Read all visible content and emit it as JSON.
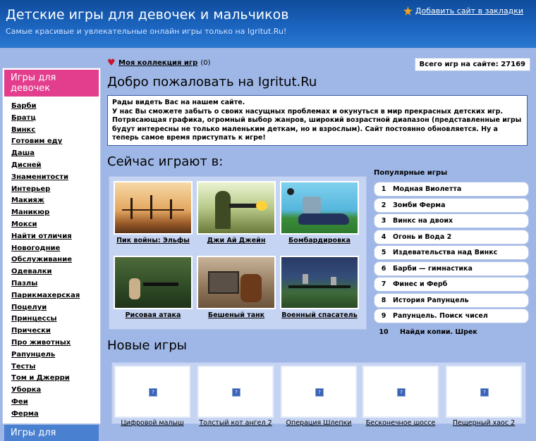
{
  "header": {
    "title": "Детские игры для девочек и мальчиков",
    "subtitle": "Самые красивые и увлекательные онлайн игры только на Igritut.Ru!",
    "bookmark": "Добавить сайт в закладки"
  },
  "sidebar": {
    "section1": "Игры для девочек",
    "items": [
      "Барби",
      "Братц",
      "Винкс",
      "Готовим еду",
      "Даша",
      "Дисней",
      "Знаменитости",
      "Интерьер",
      "Макияж",
      "Маникюр",
      "Мокси",
      "Найти отличия",
      "Новогодние",
      "Обслуживание",
      "Одевалки",
      "Пазлы",
      "Парикмахерская",
      "Поцелуи",
      "Принцессы",
      "Прически",
      "Про животных",
      "Рапунцель",
      "Тесты",
      "Том и Джерри",
      "Уборка",
      "Феи",
      "Ферма"
    ],
    "section2": "Игры для"
  },
  "collection": {
    "link": "Моя коллекция игр",
    "count": "(0)"
  },
  "total": {
    "label": "Всего игр на сайте:",
    "value": "27169"
  },
  "welcome": {
    "title": "Добро пожаловать на Igritut.Ru",
    "lines": [
      "Рады видеть Вас на нашем сайте.",
      "У нас Вы сможете забыть о своих насущных проблемах и окунуться в мир прекрасных детских игр.",
      "Потрясающая графика, огромный выбор жанров, широкий возрастной диапазон (представленные игры будут интересны не только маленьким деткам, но и взрослым). Сайт постоянно обновляется. Ну а теперь самое время приступать к игре!"
    ]
  },
  "now_playing": {
    "title": "Сейчас играют в:",
    "games": [
      "Пик войны: Эльфы",
      "Джи Ай Джейн",
      "Бомбардировка",
      "Рисовая атака",
      "Бешеный танк",
      "Военный спасатель"
    ]
  },
  "popular": {
    "title": "Популярные игры",
    "items": [
      {
        "n": "1",
        "name": "Модная Виолетта"
      },
      {
        "n": "2",
        "name": "Зомби Ферма"
      },
      {
        "n": "3",
        "name": "Винкс на двоих"
      },
      {
        "n": "4",
        "name": "Огонь и Вода 2"
      },
      {
        "n": "5",
        "name": "Издевательства над Винкс"
      },
      {
        "n": "6",
        "name": "Барби — гимнастика"
      },
      {
        "n": "7",
        "name": "Финес и Ферб"
      },
      {
        "n": "8",
        "name": "История Рапунцель"
      },
      {
        "n": "9",
        "name": "Рапунцель. Поиск чисел"
      },
      {
        "n": "10",
        "name": "Найди копии. Шрек"
      }
    ]
  },
  "new_games": {
    "title": "Новые игры",
    "games": [
      "Цифровой малыш",
      "Толстый кот ангел 2",
      "Операция Шлепки",
      "Бесконечное шоссе",
      "Пещерный хаос 2"
    ]
  },
  "colors": {
    "header": "#1c66c1",
    "girls_section": "#e33d8d",
    "page_bg": "#9fb7e6"
  }
}
